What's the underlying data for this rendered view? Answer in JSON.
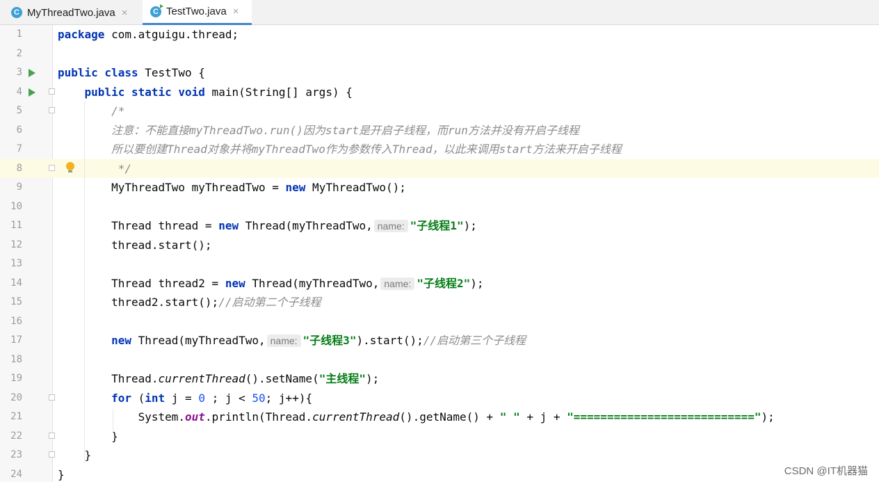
{
  "tabs": [
    {
      "label": "MyThreadTwo.java",
      "icon": "java-class-icon",
      "active": false
    },
    {
      "label": "TestTwo.java",
      "icon": "java-runnable-class-icon",
      "active": true
    }
  ],
  "tab_close_glyph": "×",
  "icon_letter": "C",
  "code_lines": [
    {
      "n": "1",
      "html": "<span class='kw'>package</span> com.atguigu.thread;"
    },
    {
      "n": "2",
      "html": ""
    },
    {
      "n": "3",
      "html": "<span class='kw'>public class</span> TestTwo {",
      "run": true
    },
    {
      "n": "4",
      "html": "    <span class='kw'>public static void</span> main(String[] args) {",
      "run": true,
      "fold": true
    },
    {
      "n": "5",
      "html": "        <span class='cm'>/*</span>",
      "fold": true
    },
    {
      "n": "6",
      "html": "        <span class='cm'>注意：不能直接myThreadTwo.run()因为start是开启子线程，而run方法并没有开启子线程</span>"
    },
    {
      "n": "7",
      "html": "        <span class='cm'>所以要创建Thread对象并将myThreadTwo作为参数传入Thread，以此来调用start方法来开启子线程</span>"
    },
    {
      "n": "8",
      "html": "         <span class='cm'>*/</span>",
      "fold": true,
      "bulb": true,
      "highlight": true
    },
    {
      "n": "9",
      "html": "        MyThreadTwo myThreadTwo = <span class='kw'>new</span> MyThreadTwo();"
    },
    {
      "n": "10",
      "html": ""
    },
    {
      "n": "11",
      "html": "        Thread thread = <span class='kw'>new</span> Thread(myThreadTwo,<span class='hint'>name:</span><span class='str'>\"子线程1\"</span>);"
    },
    {
      "n": "12",
      "html": "        thread.start();"
    },
    {
      "n": "13",
      "html": ""
    },
    {
      "n": "14",
      "html": "        Thread thread2 = <span class='kw'>new</span> Thread(myThreadTwo,<span class='hint'>name:</span><span class='str'>\"子线程2\"</span>);"
    },
    {
      "n": "15",
      "html": "        thread2.start();<span class='cm'>//启动第二个子线程</span>"
    },
    {
      "n": "16",
      "html": ""
    },
    {
      "n": "17",
      "html": "        <span class='kw'>new</span> Thread(myThreadTwo,<span class='hint'>name:</span><span class='str'>\"子线程3\"</span>).start();<span class='cm'>//启动第三个子线程</span>"
    },
    {
      "n": "18",
      "html": ""
    },
    {
      "n": "19",
      "html": "        Thread.<span class='it'>currentThread</span>().setName(<span class='str'>\"主线程\"</span>);"
    },
    {
      "n": "20",
      "html": "        <span class='kw'>for</span> (<span class='kw'>int</span> j = <span class='num'>0</span> ; j &lt; <span class='num'>50</span>; j++){",
      "fold": true
    },
    {
      "n": "21",
      "html": "            System.<span class='fld'>out</span>.println(Thread.<span class='it'>currentThread</span>().getName() + <span class='str'>\" \"</span> + j + <span class='str'>\"===========================\"</span>);"
    },
    {
      "n": "22",
      "html": "        }",
      "fold": true
    },
    {
      "n": "23",
      "html": "    }",
      "fold": true
    },
    {
      "n": "24",
      "html": "}"
    }
  ],
  "watermark": "CSDN @IT机器猫"
}
